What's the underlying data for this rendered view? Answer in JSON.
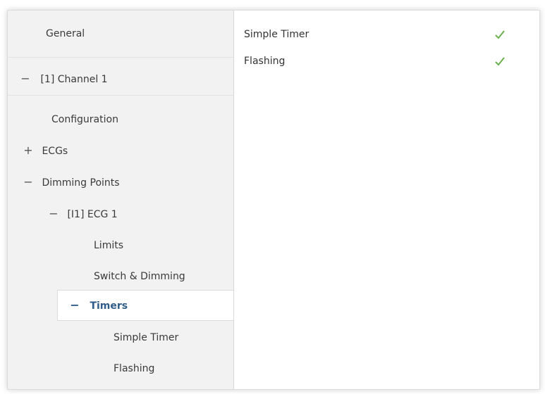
{
  "sidebar": {
    "general": "General",
    "channel": {
      "symbol": "−",
      "label": "[1] Channel 1"
    },
    "configuration": "Configuration",
    "ecgs": {
      "symbol": "+",
      "label": "ECGs"
    },
    "dimming_points": {
      "symbol": "−",
      "label": "Dimming Points"
    },
    "ecg1": {
      "symbol": "−",
      "label": "[I1] ECG 1"
    },
    "limits": "Limits",
    "switch_dimming": "Switch & Dimming",
    "timers": {
      "symbol": "−",
      "label": "Timers"
    },
    "simple_timer": "Simple Timer",
    "flashing": "Flashing"
  },
  "main": {
    "params": [
      {
        "label": "Simple Timer",
        "checked": true,
        "icon": "checkmark-icon"
      },
      {
        "label": "Flashing",
        "checked": true,
        "icon": "checkmark-icon"
      }
    ]
  },
  "colors": {
    "selected_text": "#2f5d8a",
    "check_green": "#6ab04c"
  }
}
